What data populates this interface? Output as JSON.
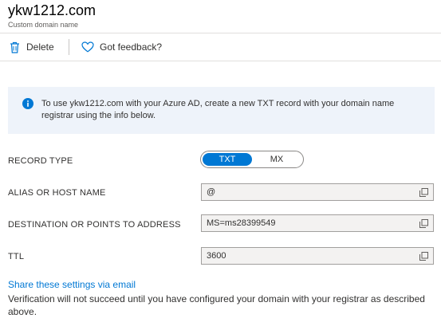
{
  "header": {
    "title": "ykw1212.com",
    "subtitle": "Custom domain name"
  },
  "toolbar": {
    "delete_label": "Delete",
    "feedback_label": "Got feedback?",
    "delete_icon": "trash-icon",
    "feedback_icon": "heart-icon"
  },
  "info": {
    "icon": "info-icon",
    "text": "To use ykw1212.com with your Azure AD, create a new TXT record with your domain name registrar using the info below."
  },
  "record": {
    "type_label": "RECORD TYPE",
    "options": [
      "TXT",
      "MX"
    ],
    "selected": "TXT",
    "alias_label": "ALIAS OR HOST NAME",
    "alias_value": "@",
    "destination_label": "DESTINATION OR POINTS TO ADDRESS",
    "destination_value": "MS=ms28399549",
    "ttl_label": "TTL",
    "ttl_value": "3600",
    "copy_icon": "copy-icon"
  },
  "footer": {
    "share_link": "Share these settings via email",
    "note": "Verification will not succeed until you have configured your domain with your registrar as described above."
  },
  "colors": {
    "accent": "#0078d4",
    "info_background": "#eef3fa",
    "field_background": "#f3f2f1"
  }
}
